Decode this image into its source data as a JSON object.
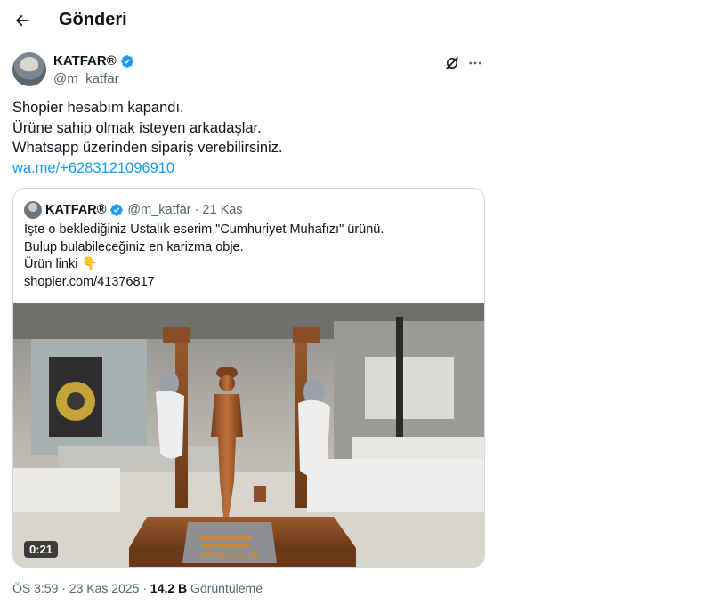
{
  "header": {
    "title": "Gönderi"
  },
  "author": {
    "name": "KATFAR®",
    "handle": "@m_katfar"
  },
  "post": {
    "lines": [
      "Shopier hesabım kapandı.",
      "Ürüne sahip olmak isteyen arkadaşlar.",
      "Whatsapp üzerinden sipariş verebilirsiniz."
    ],
    "link": "wa.me/+6283121096910"
  },
  "quote": {
    "name": "KATFAR®",
    "handle": "@m_katfar",
    "separator": "·",
    "date": "21 Kas",
    "lines": [
      "İşte o beklediğiniz Ustalık eserim \"Cumhuriyet Muhafızı\" ürünü.",
      "Bulup bulabileceğiniz en karizma obje.",
      "Ürün linki 👇",
      "shopier.com/41376817"
    ],
    "media": {
      "duration": "0:21",
      "plaque_line1": "BEDEL OLUR"
    }
  },
  "footer": {
    "time": "ÖS 3:59",
    "separator": "·",
    "date": "23 Kas 2025",
    "views_count": "14,2 B",
    "views_label": "Görüntüleme"
  },
  "colors": {
    "accent": "#1d9bf0",
    "verified": "#1d9bf0",
    "muted": "#536471",
    "border": "#cfd9de"
  }
}
